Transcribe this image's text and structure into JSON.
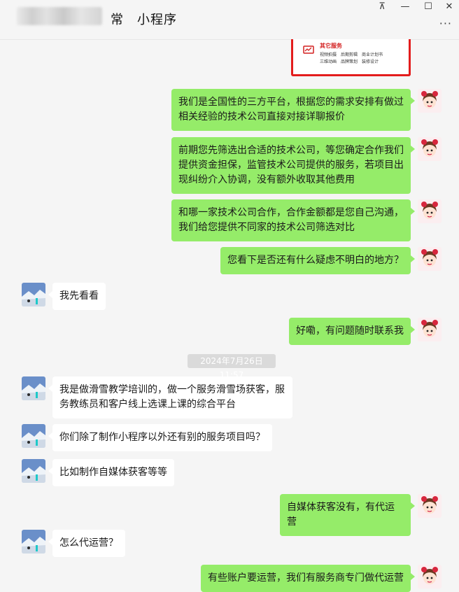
{
  "window": {
    "title": "常　小程序",
    "controls": {
      "pin": "⊼",
      "minimize": "—",
      "maximize": "☐",
      "close": "✕"
    },
    "more": "···"
  },
  "card": {
    "title": "其它服务",
    "line1": "视频拍摄　后期剪辑　商业计划书",
    "line2": "三维动画　品牌策划　装修设计"
  },
  "timestamp": "2024年7月26日 11:57",
  "messages": {
    "m1": "我们是全国性的三方平台，根据您的需求安排有做过相关经验的技术公司直接对接详聊报价",
    "m2": "前期您先筛选出合适的技术公司，等您确定合作我们提供资金担保，监管技术公司提供的服务，若项目出现纠纷介入协调，没有额外收取其他费用",
    "m3": "和哪一家技术公司合作，合作金额都是您自己沟通，我们给您提供不同家的技术公司筛选对比",
    "m4": "您看下是否还有什么疑虑不明白的地方？",
    "m5": "我先看看",
    "m6": "好嘞，有问题随时联系我",
    "m7": "我是做滑雪教学培训的，做一个服务滑雪场获客，服务教练员和客户线上选课上课的综合平台",
    "m8": "你们除了制作小程序以外还有别的服务项目吗？",
    "m9": "比如制作自媒体获客等等",
    "m10": "自媒体获客没有，有代运营",
    "m11": "怎么代运营？",
    "m12": "有些账户要运营，我们有服务商专门做代运营"
  }
}
